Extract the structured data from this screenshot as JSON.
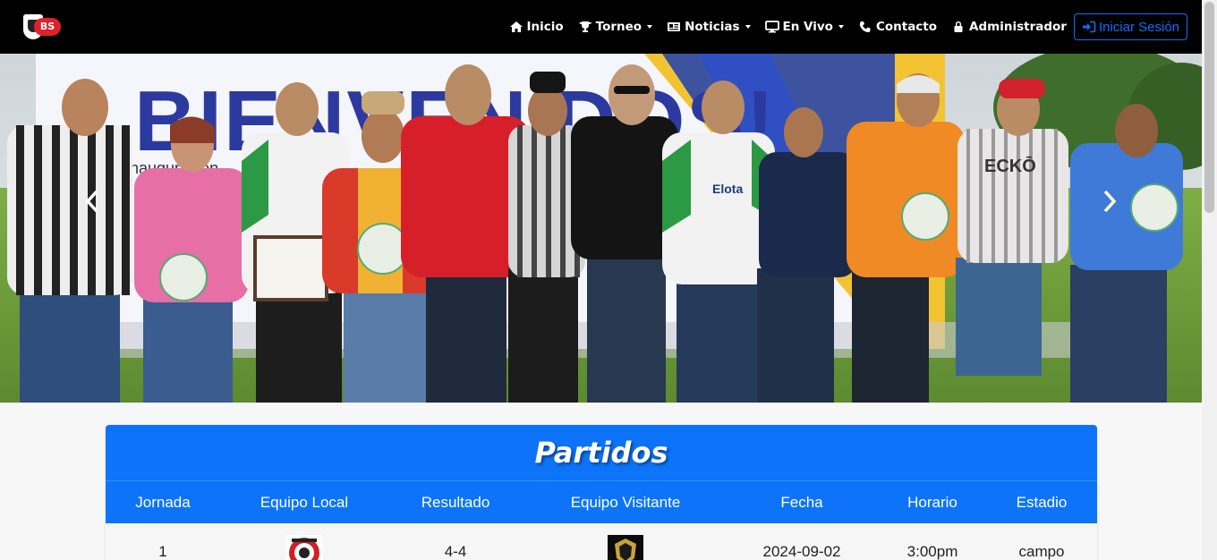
{
  "brand": {
    "logo_text": "BS"
  },
  "nav": {
    "items": [
      {
        "label": "Inicio",
        "icon": "home-icon"
      },
      {
        "label": "Torneo",
        "icon": "trophy-icon",
        "dropdown": true
      },
      {
        "label": "Noticias",
        "icon": "newspaper-icon",
        "dropdown": true
      },
      {
        "label": "En Vivo",
        "icon": "monitor-icon",
        "dropdown": true
      },
      {
        "label": "Contacto",
        "icon": "phone-icon"
      },
      {
        "label": "Administrador",
        "icon": "lock-icon"
      }
    ],
    "login_label": "Iniciar Sesión"
  },
  "hero": {
    "banner_text": "BIENVENIDOS!",
    "banner_subtext": "Inauguración",
    "shirt_text_1": "Elota",
    "shirt_text_2": "ECKŌ"
  },
  "colors": {
    "navbar": "#000000",
    "accent": "#0d74fa",
    "login": "#0d6efd"
  },
  "matches": {
    "title": "Partidos",
    "columns": [
      "Jornada",
      "Equipo Local",
      "Resultado",
      "Equipo Visitante",
      "Fecha",
      "Horario",
      "Estadio"
    ],
    "rows": [
      {
        "jornada": "1",
        "local_logo": "team-logo-red",
        "resultado": "4-4",
        "visitante_logo": "team-logo-mineros",
        "fecha": "2024-09-02",
        "horario": "3:00pm",
        "estadio": "campo"
      }
    ]
  }
}
